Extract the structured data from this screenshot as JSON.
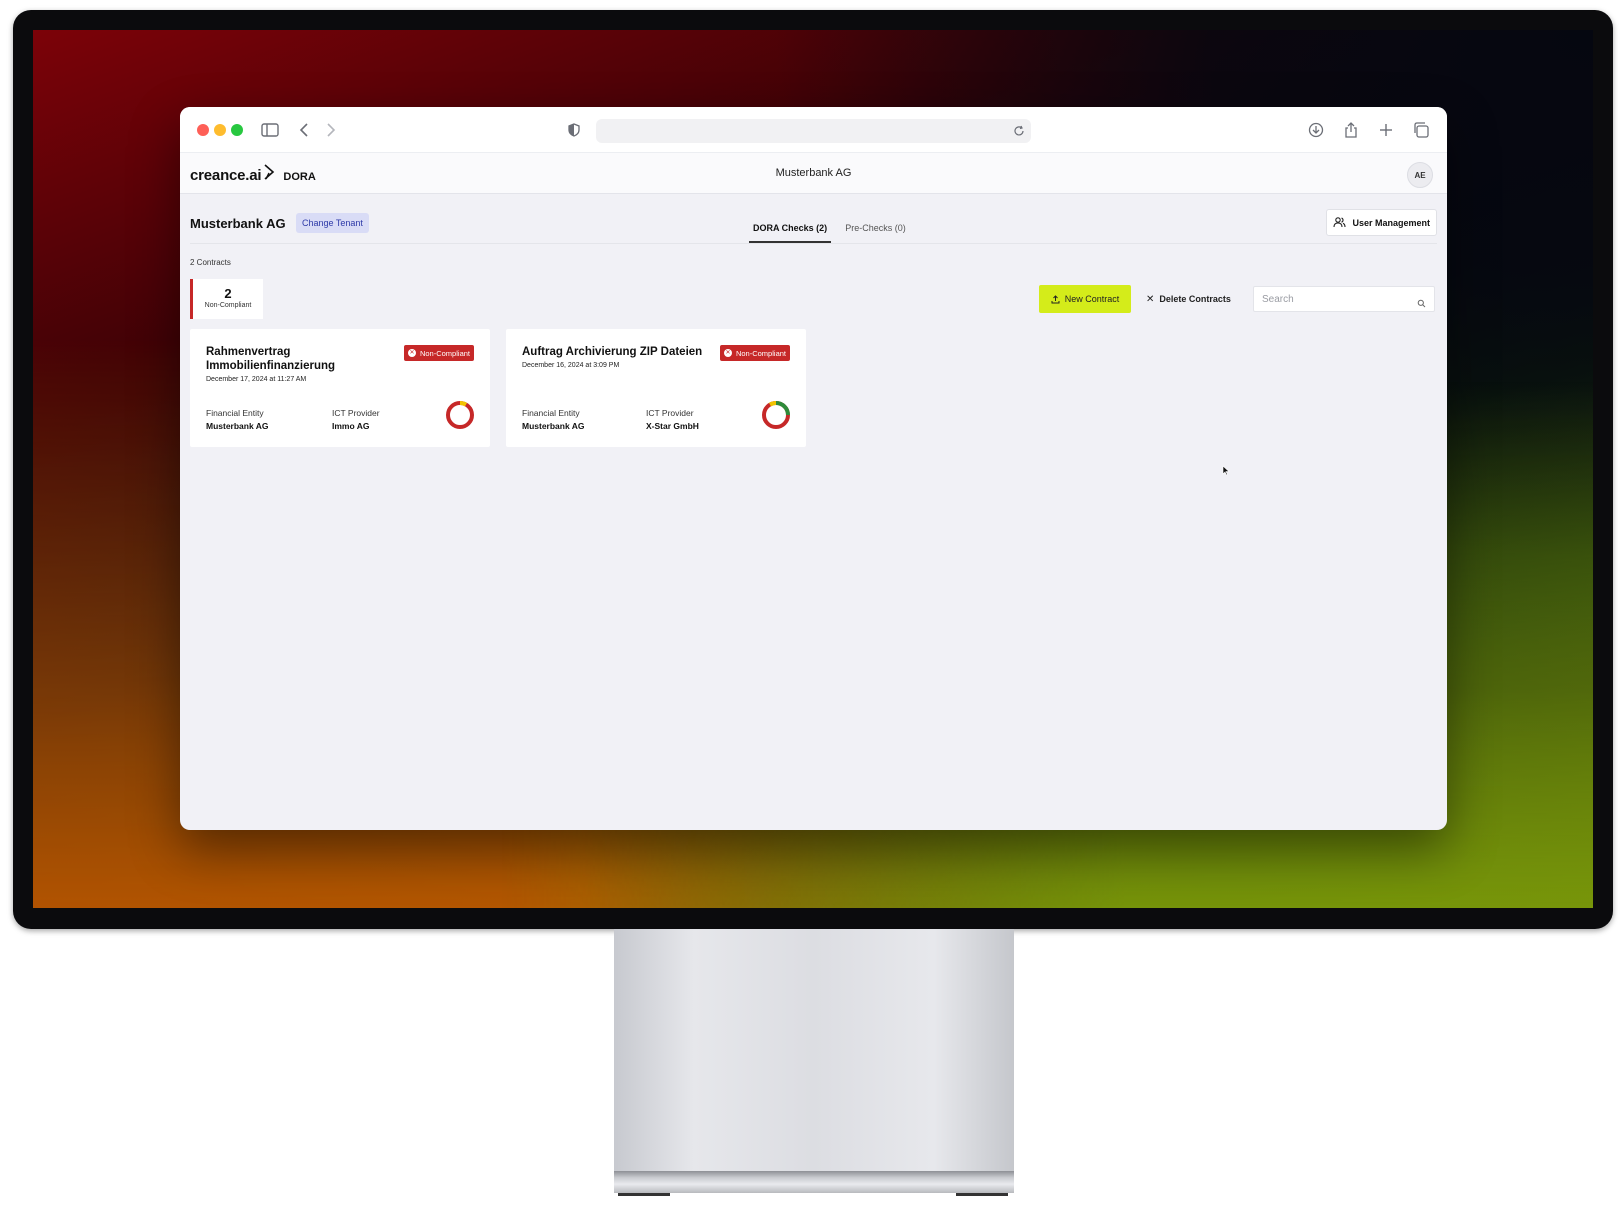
{
  "header": {
    "logo_text": "creance.ai",
    "product": "DORA",
    "tenant": "Musterbank AG",
    "avatar_initials": "AE"
  },
  "subheader": {
    "tenant_title": "Musterbank AG",
    "change_tenant_label": "Change Tenant",
    "tabs": [
      {
        "label": "DORA Checks (2)",
        "active": true
      },
      {
        "label": "Pre-Checks (0)",
        "active": false
      }
    ],
    "user_management_label": "User Management"
  },
  "summary": {
    "contracts_count": "2 Contracts",
    "stat_number": "2",
    "stat_label": "Non-Compliant"
  },
  "actions": {
    "new_contract_label": "New Contract",
    "delete_contracts_label": "Delete Contracts",
    "search_placeholder": "Search"
  },
  "cards": [
    {
      "title": "Rahmenvertrag Immobilienfinanzierung",
      "date": "December 17, 2024 at 11:27 AM",
      "badge": "Non-Compliant",
      "financial_entity_label": "Financial Entity",
      "financial_entity": "Musterbank AG",
      "ict_provider_label": "ICT Provider",
      "ict_provider": "Immo AG"
    },
    {
      "title": "Auftrag Archivierung ZIP Dateien",
      "date": "December 16, 2024 at 3:09 PM",
      "badge": "Non-Compliant",
      "financial_entity_label": "Financial Entity",
      "financial_entity": "Musterbank AG",
      "ict_provider_label": "ICT Provider",
      "ict_provider": "X-Star GmbH"
    }
  ],
  "colors": {
    "accent": "#d4ec1a",
    "non_compliant": "#c62828",
    "partial": "#f2c400",
    "compliant": "#2e8b3a"
  }
}
